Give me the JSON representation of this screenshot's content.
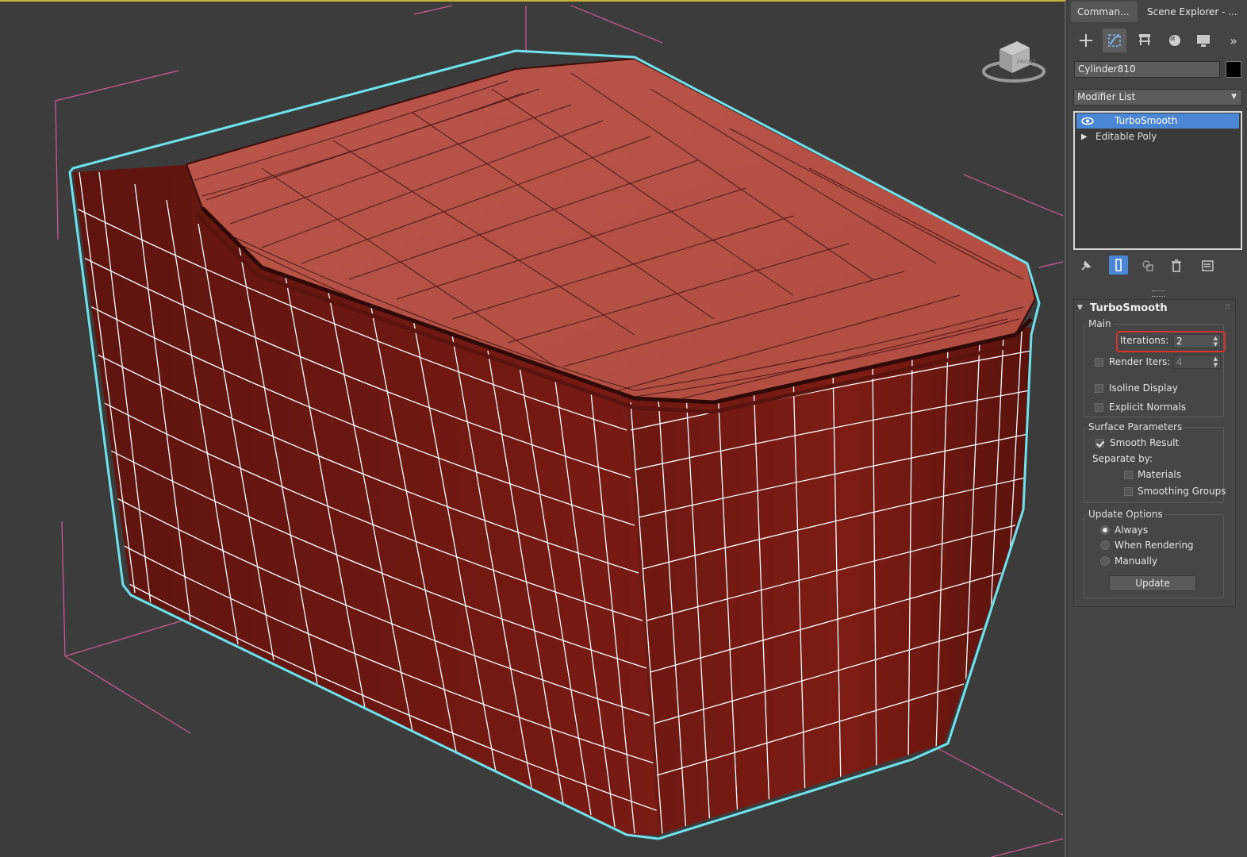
{
  "tabs": [
    {
      "label": "Comman..."
    },
    {
      "label": "Scene Explorer - ..."
    }
  ],
  "toolbar": {
    "items": [
      "create-icon",
      "modify-icon",
      "hierarchy-icon",
      "motion-icon",
      "display-icon",
      "more-icon"
    ],
    "more": "»"
  },
  "object": {
    "name": "Cylinder810",
    "color": "#000000"
  },
  "modifier_list": {
    "label": "Modifier List"
  },
  "stack": [
    {
      "label": "TurboSmooth",
      "selected": true
    },
    {
      "label": "Editable Poly",
      "selected": false
    }
  ],
  "turbosmooth": {
    "title": "TurboSmooth",
    "main": {
      "group_label": "Main",
      "iterations_label": "Iterations:",
      "iterations_value": "2",
      "render_iters_label": "Render Iters:",
      "render_iters_value": "4",
      "isoline_label": "Isoline Display",
      "explicit_normals_label": "Explicit Normals"
    },
    "surface": {
      "group_label": "Surface Parameters",
      "smooth_result_label": "Smooth Result",
      "separate_by_label": "Separate by:",
      "materials_label": "Materials",
      "smoothing_groups_label": "Smoothing Groups"
    },
    "update": {
      "group_label": "Update Options",
      "always_label": "Always",
      "when_rendering_label": "When Rendering",
      "manually_label": "Manually",
      "update_button": "Update"
    }
  },
  "colors": {
    "selection": "#4a86d4",
    "mesh": "#8b1f18",
    "wire": "#ffffff",
    "outline": "#6fe3ec",
    "bbox": "#e0609a",
    "highlight": "#d93030"
  }
}
